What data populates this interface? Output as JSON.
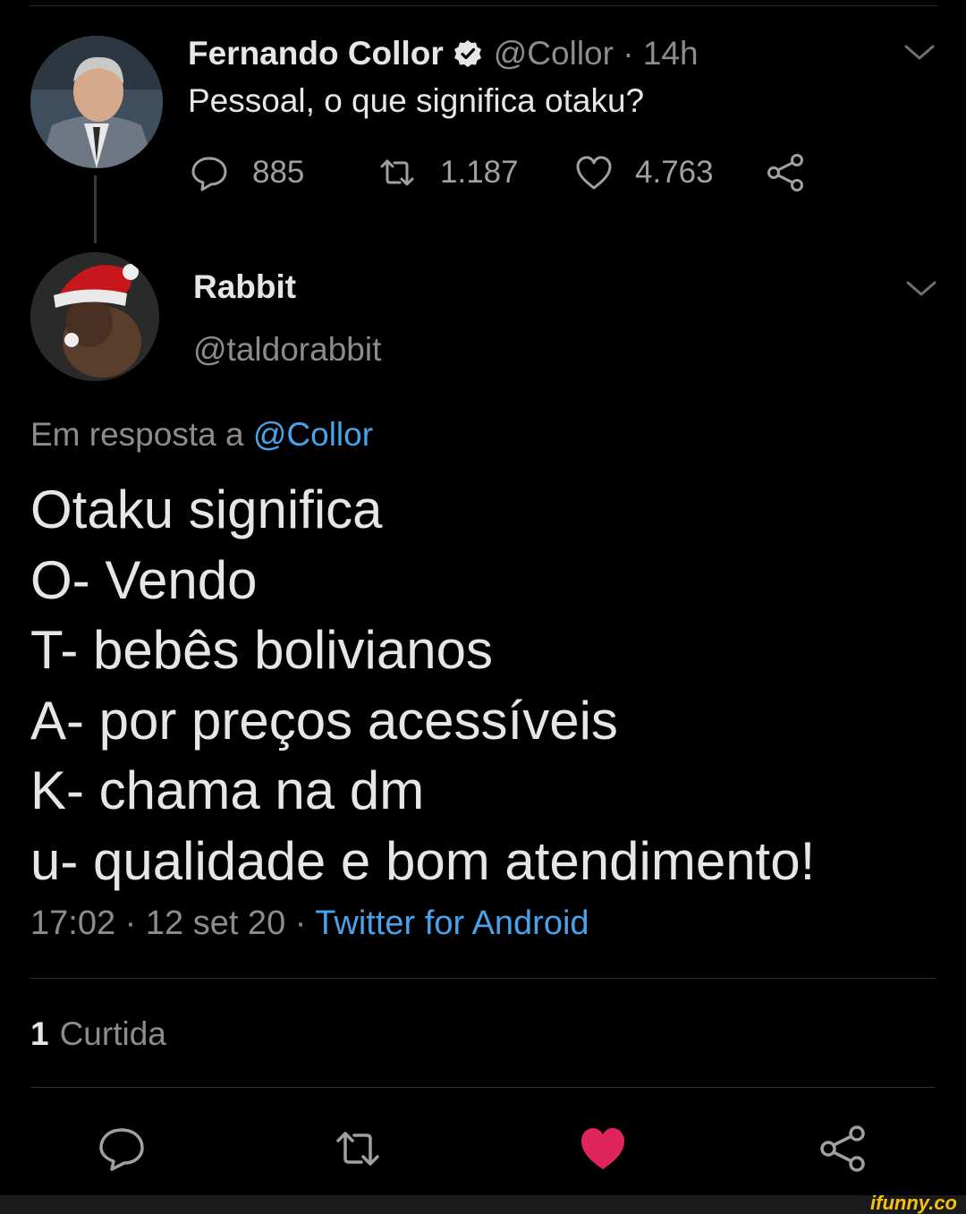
{
  "parent_tweet": {
    "author_name": "Fernando Collor",
    "handle_time": "@Collor · 14h",
    "text": "Pessoal, o que significa otaku?",
    "stats": {
      "replies": "885",
      "retweets": "1.187",
      "likes": "4.763"
    }
  },
  "reply_tweet": {
    "author_name": "Rabbit",
    "handle": "@taldorabbit",
    "in_reply_prefix": "Em resposta a ",
    "in_reply_handle": "@Collor",
    "lines": [
      "Otaku significa",
      "O- Vendo",
      "T- bebês bolivianos",
      "A- por preços acessíveis",
      "K- chama na dm",
      "u- qualidade e bom atendimento!"
    ],
    "time_date": "17:02 · 12 set 20 · ",
    "source": "Twitter for Android",
    "likes_count": "1",
    "likes_label": "Curtida"
  },
  "watermark": "ifunny.co",
  "colors": {
    "background": "#000000",
    "link": "#4aa3e8",
    "like_active": "#e0245e",
    "muted": "#8c8c8c"
  },
  "icons": [
    "verified-badge-icon",
    "chevron-down-icon",
    "reply-icon",
    "retweet-icon",
    "heart-icon",
    "share-icon"
  ]
}
